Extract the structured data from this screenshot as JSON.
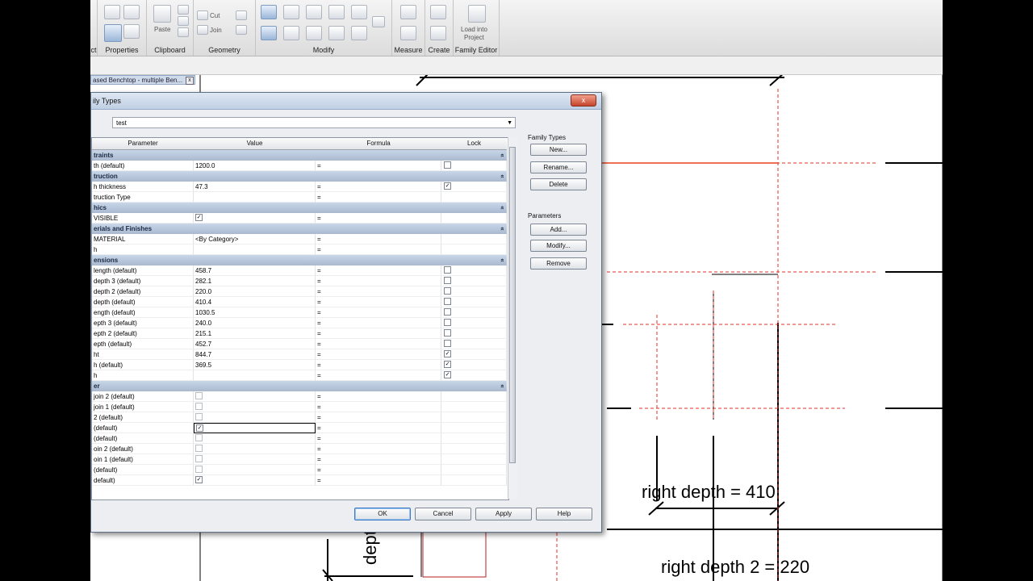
{
  "ribbon": {
    "panels": [
      {
        "label": "ct"
      },
      {
        "label": "Properties"
      },
      {
        "label": "Clipboard",
        "paste": "Paste"
      },
      {
        "label": "Geometry",
        "cut": "Cut",
        "join": "Join"
      },
      {
        "label": "Modify"
      },
      {
        "label": "Measure"
      },
      {
        "label": "Create"
      },
      {
        "label": "Family Editor",
        "load_line1": "Load into",
        "load_line2": "Project"
      }
    ]
  },
  "document_tab": {
    "title": "ased Benchtop - multiple Ben...",
    "close": "x"
  },
  "drawing": {
    "labels": [
      {
        "text": "right depth = 410"
      },
      {
        "text": "right depth 2 = 220"
      },
      {
        "text": "depth"
      }
    ]
  },
  "dialog": {
    "title": "ily Types",
    "close": "x",
    "type_name": "test",
    "columns": [
      "Parameter",
      "Value",
      "Formula",
      "Lock"
    ],
    "rows": [
      {
        "group": "traints"
      },
      {
        "param": "th (default)",
        "value": "1200.0",
        "formula": "=",
        "lock": "off"
      },
      {
        "group": "truction"
      },
      {
        "param": "h thickness",
        "value": "47.3",
        "formula": "=",
        "lock": "on"
      },
      {
        "param": "truction Type",
        "value": "",
        "formula": "=",
        "lock": "none"
      },
      {
        "group": "hics"
      },
      {
        "param": "VISIBLE",
        "value": "",
        "valueCheck": "on",
        "formula": "=",
        "lock": "none"
      },
      {
        "group": "erials and Finishes"
      },
      {
        "param": "MATERIAL",
        "value": "<By Category>",
        "formula": "=",
        "lock": "none"
      },
      {
        "param": "h",
        "value": "",
        "formula": "=",
        "lock": "none"
      },
      {
        "group": "ensions"
      },
      {
        "param": "length (default)",
        "value": "458.7",
        "formula": "=",
        "lock": "off"
      },
      {
        "param": "depth 3 (default)",
        "value": "282.1",
        "formula": "=",
        "lock": "off"
      },
      {
        "param": "depth 2 (default)",
        "value": "220.0",
        "formula": "=",
        "lock": "off"
      },
      {
        "param": "depth (default)",
        "value": "410.4",
        "formula": "=",
        "lock": "off"
      },
      {
        "param": "ength (default)",
        "value": "1030.5",
        "formula": "=",
        "lock": "off"
      },
      {
        "param": "epth 3 (default)",
        "value": "240.0",
        "formula": "=",
        "lock": "off"
      },
      {
        "param": "epth 2 (default)",
        "value": "215.1",
        "formula": "=",
        "lock": "off"
      },
      {
        "param": "epth (default)",
        "value": "452.7",
        "formula": "=",
        "lock": "off"
      },
      {
        "param": "ht",
        "value": "844.7",
        "formula": "=",
        "lock": "on"
      },
      {
        "param": "h (default)",
        "value": "369.5",
        "formula": "=",
        "lock": "on"
      },
      {
        "param": "h",
        "value": "",
        "formula": "=",
        "lock": "on"
      },
      {
        "group": "er"
      },
      {
        "param": "join 2 (default)",
        "value": "",
        "valueCheck": "off",
        "formula": "=",
        "lock": "none"
      },
      {
        "param": "join 1 (default)",
        "value": "",
        "valueCheck": "off",
        "formula": "=",
        "lock": "none"
      },
      {
        "param": "2 (default)",
        "value": "",
        "valueCheck": "off",
        "formula": "=",
        "lock": "none"
      },
      {
        "param": "(default)",
        "value": "",
        "valueCheck": "on",
        "formula": "=",
        "lock": "none",
        "focused": true
      },
      {
        "param": "(default)",
        "value": "",
        "valueCheck": "off",
        "formula": "=",
        "lock": "none"
      },
      {
        "param": "oin 2 (default)",
        "value": "",
        "valueCheck": "off",
        "formula": "=",
        "lock": "none"
      },
      {
        "param": "oin 1 (default)",
        "value": "",
        "valueCheck": "off",
        "formula": "=",
        "lock": "none"
      },
      {
        "param": "(default)",
        "value": "",
        "valueCheck": "off",
        "formula": "=",
        "lock": "none"
      },
      {
        "param": "default)",
        "value": "",
        "valueCheck": "on",
        "formula": "=",
        "lock": "none"
      }
    ],
    "family_types": {
      "label": "Family Types",
      "new": "New...",
      "rename": "Rename...",
      "delete": "Delete"
    },
    "parameters": {
      "label": "Parameters",
      "add": "Add...",
      "modify": "Modify...",
      "remove": "Remove"
    },
    "buttons": {
      "ok": "OK",
      "cancel": "Cancel",
      "apply": "Apply",
      "help": "Help"
    }
  }
}
